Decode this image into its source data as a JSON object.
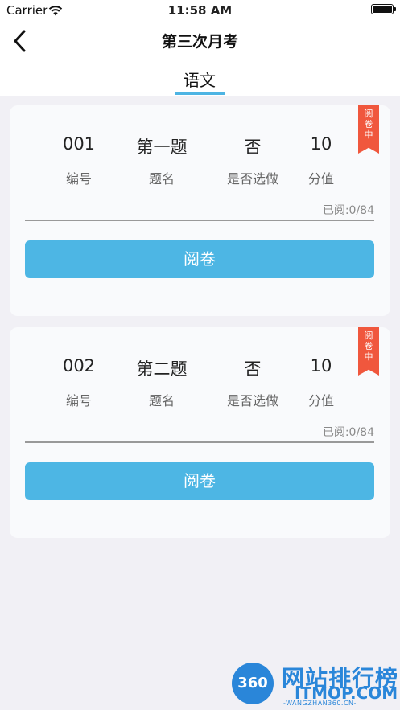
{
  "status_bar": {
    "carrier": "Carrier",
    "time": "11:58 AM"
  },
  "nav": {
    "title": "第三次月考"
  },
  "subject_tab": {
    "label": "语文"
  },
  "cards": [
    {
      "ribbon": [
        "阅",
        "卷",
        "中"
      ],
      "values": [
        "001",
        "第一题",
        "否",
        "10"
      ],
      "labels": [
        "编号",
        "题名",
        "是否选做",
        "分值"
      ],
      "progress": "已阅:0/84",
      "button": "阅卷"
    },
    {
      "ribbon": [
        "阅",
        "卷",
        "中"
      ],
      "values": [
        "002",
        "第二题",
        "否",
        "10"
      ],
      "labels": [
        "编号",
        "题名",
        "是否选做",
        "分值"
      ],
      "progress": "已阅:0/84",
      "button": "阅卷"
    }
  ],
  "watermark": {
    "badge": "360",
    "title": "网站排行榜",
    "site": "ITMOP.COM",
    "url": "-WANGZHAN360.CN-"
  },
  "colors": {
    "accent": "#4db6e4",
    "ribbon": "#f0573d",
    "brand": "#2a86d9"
  }
}
